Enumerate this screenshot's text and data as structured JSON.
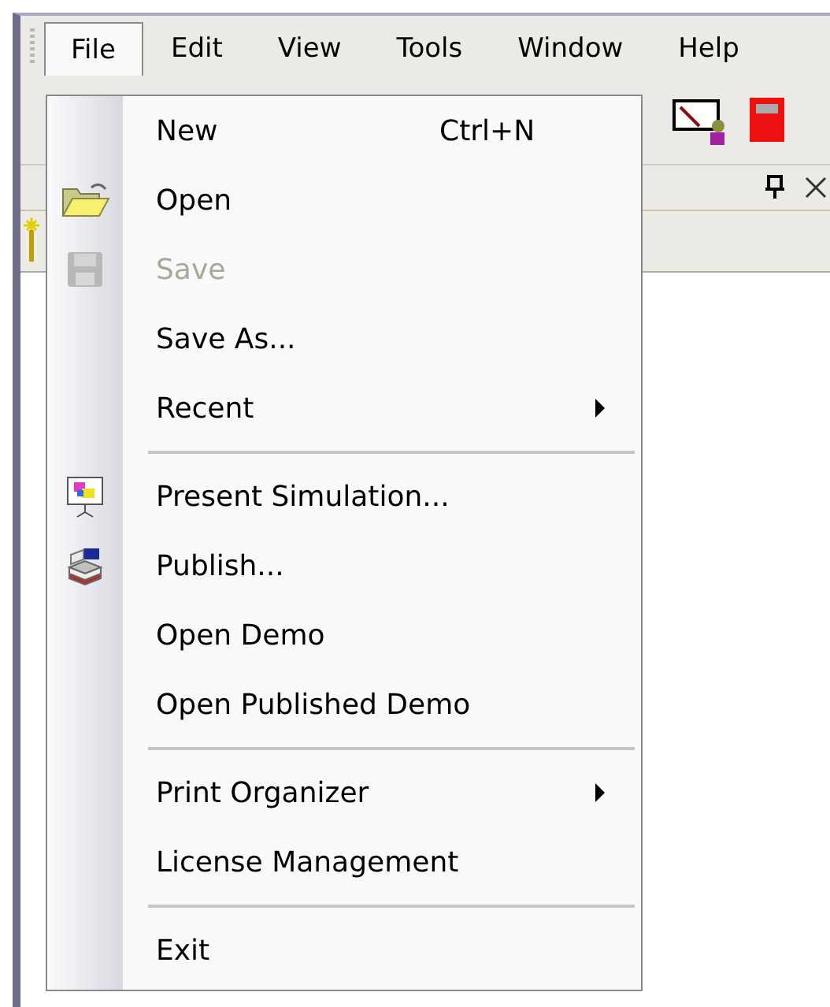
{
  "menubar": [
    {
      "label": "File",
      "selected": true
    },
    {
      "label": "Edit",
      "selected": false
    },
    {
      "label": "View",
      "selected": false
    },
    {
      "label": "Tools",
      "selected": false
    },
    {
      "label": "Window",
      "selected": false
    },
    {
      "label": "Help",
      "selected": false
    }
  ],
  "file_menu": [
    {
      "kind": "item",
      "label": "New",
      "shortcut": "Ctrl+N",
      "disabled": false,
      "submenu": false
    },
    {
      "kind": "item",
      "label": "Open",
      "disabled": false,
      "submenu": false
    },
    {
      "kind": "item",
      "label": "Save",
      "disabled": true,
      "submenu": false
    },
    {
      "kind": "item",
      "label": "Save As...",
      "disabled": false,
      "submenu": false
    },
    {
      "kind": "item",
      "label": "Recent",
      "disabled": false,
      "submenu": true
    },
    {
      "kind": "separator"
    },
    {
      "kind": "item",
      "label": "Present Simulation...",
      "disabled": false,
      "submenu": false
    },
    {
      "kind": "item",
      "label": "Publish...",
      "disabled": false,
      "submenu": false
    },
    {
      "kind": "item",
      "label": "Open Demo",
      "disabled": false,
      "submenu": false
    },
    {
      "kind": "item",
      "label": "Open Published Demo",
      "disabled": false,
      "submenu": false
    },
    {
      "kind": "separator"
    },
    {
      "kind": "item",
      "label": "Print Organizer",
      "disabled": false,
      "submenu": true
    },
    {
      "kind": "item",
      "label": "License Management",
      "disabled": false,
      "submenu": false
    },
    {
      "kind": "separator"
    },
    {
      "kind": "item",
      "label": "Exit",
      "disabled": false,
      "submenu": false
    }
  ]
}
